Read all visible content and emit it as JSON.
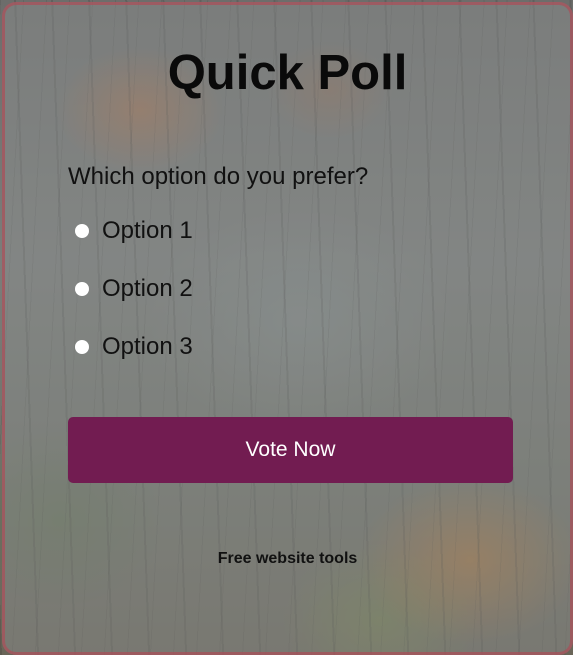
{
  "poll": {
    "title": "Quick Poll",
    "question": "Which option do you prefer?",
    "options": [
      {
        "label": "Option 1",
        "selected": false
      },
      {
        "label": "Option 2",
        "selected": false
      },
      {
        "label": "Option 3",
        "selected": false
      }
    ],
    "vote_label": "Vote Now"
  },
  "footer": {
    "text": "Free website tools"
  },
  "colors": {
    "accent": "#721c51",
    "card_border": "#aa505a",
    "radio_fill": "#ffffff"
  }
}
